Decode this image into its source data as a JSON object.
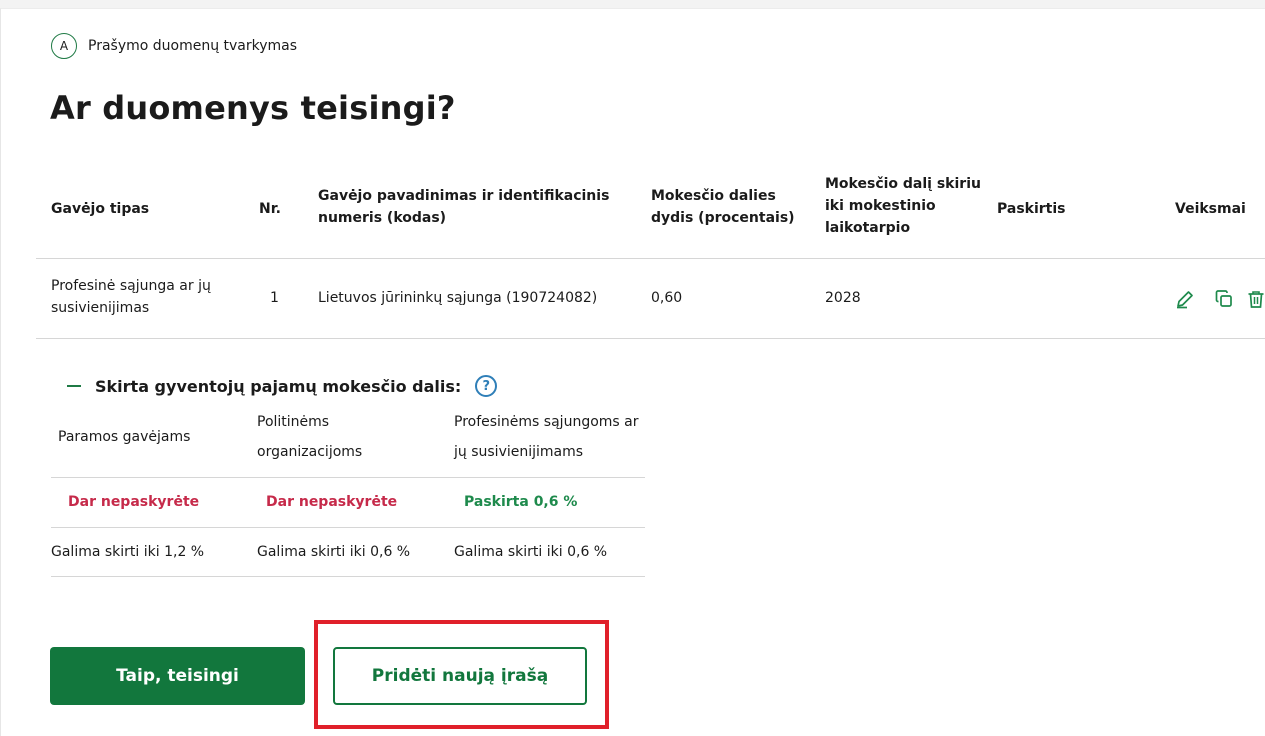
{
  "step": {
    "letter": "A",
    "label": "Prašymo duomenų tvarkymas"
  },
  "title": "Ar duomenys teisingi?",
  "table": {
    "headers": {
      "type": "Gavėjo tipas",
      "nr": "Nr.",
      "name": "Gavėjo pavadinimas ir identifikacinis numeris (kodas)",
      "share": "Mokesčio dalies dydis (procentais)",
      "until": "Mokesčio dalį skiriu iki mokestinio laikotarpio",
      "purpose": "Paskirtis",
      "actions": "Veiksmai"
    },
    "rows": [
      {
        "type": "Profesinė sąjunga ar jų susivienijimas",
        "nr": "1",
        "name": "Lietuvos jūrininkų sąjunga (190724082)",
        "share": "0,60",
        "until": "2028",
        "purpose": ""
      }
    ],
    "actions": {
      "edit_icon": "pencil-icon",
      "copy_icon": "copy-icon",
      "delete_icon": "trash-icon"
    }
  },
  "summary": {
    "title": "Skirta gyventojų pajamų mokesčio dalis:",
    "help": "?",
    "columns": [
      {
        "header": "Paramos gavėjams",
        "status": "Dar nepaskyrėte",
        "limit": "Galima skirti iki 1,2 %"
      },
      {
        "header": "Politinėms organizacijoms",
        "status": "Dar nepaskyrėte",
        "limit": "Galima skirti iki 0,6 %"
      },
      {
        "header": "Profesinėms sąjungoms ar jų susivienijimams",
        "status": "Paskirta 0,6 %",
        "limit": "Galima skirti iki 0,6 %"
      }
    ]
  },
  "buttons": {
    "confirm": "Taip, teisingi",
    "add": "Pridėti naują įrašą"
  },
  "colors": {
    "primary": "#12773d",
    "status_red": "#c62a4a",
    "status_green": "#1e8a4c",
    "highlight": "#e0202a",
    "help": "#2f7fb8"
  }
}
